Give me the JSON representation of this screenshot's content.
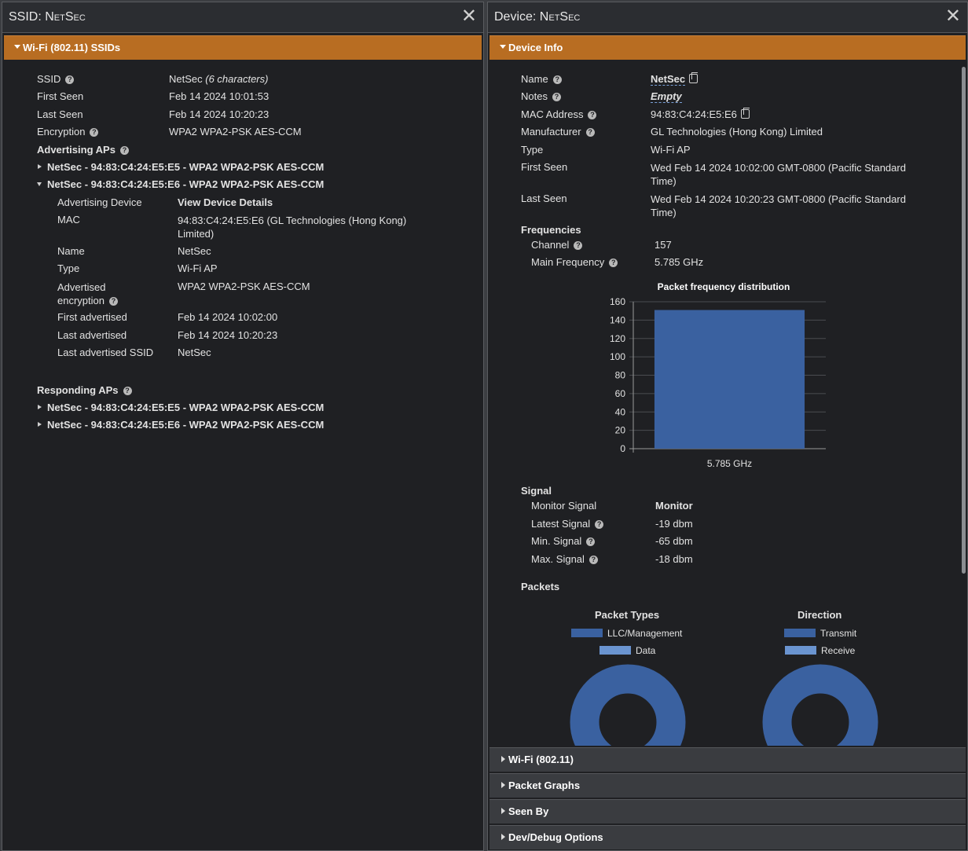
{
  "left": {
    "title_prefix": "SSID: ",
    "title_name": "NetSec",
    "section": "Wi-Fi (802.11) SSIDs",
    "fields": [
      {
        "label": "SSID",
        "value": "NetSec",
        "note": "(6 characters)"
      },
      {
        "label": "First Seen",
        "value": "Feb 14 2024 10:01:53"
      },
      {
        "label": "Last Seen",
        "value": "Feb 14 2024 10:20:23"
      },
      {
        "label": "Encryption",
        "value": "WPA2 WPA2-PSK AES-CCM"
      }
    ],
    "advertising_title": "Advertising APs",
    "advertising": [
      "NetSec - 94:83:C4:24:E5:E5 - WPA2 WPA2-PSK AES-CCM",
      "NetSec - 94:83:C4:24:E5:E6 - WPA2 WPA2-PSK AES-CCM"
    ],
    "detail": {
      "advertising_device_label": "Advertising Device",
      "advertising_device_value": "View Device Details",
      "mac_label": "MAC",
      "mac_value": "94:83:C4:24:E5:E6 (GL Technologies (Hong Kong) Limited)",
      "name_label": "Name",
      "name_value": "NetSec",
      "type_label": "Type",
      "type_value": "Wi-Fi AP",
      "adv_enc_label": "Advertised encryption",
      "adv_enc_value": "WPA2 WPA2-PSK AES-CCM",
      "first_adv_label": "First advertised",
      "first_adv_value": "Feb 14 2024 10:02:00",
      "last_adv_label": "Last advertised",
      "last_adv_value": "Feb 14 2024 10:20:23",
      "last_ssid_label": "Last advertised SSID",
      "last_ssid_value": "NetSec"
    },
    "responding_title": "Responding APs",
    "responding": [
      "NetSec - 94:83:C4:24:E5:E5 - WPA2 WPA2-PSK AES-CCM",
      "NetSec - 94:83:C4:24:E5:E6 - WPA2 WPA2-PSK AES-CCM"
    ]
  },
  "right": {
    "title_prefix": "Device: ",
    "title_name": "NetSec",
    "section": "Device Info",
    "info": {
      "name_label": "Name",
      "name_value": "NetSec",
      "notes_label": "Notes",
      "notes_value": "Empty",
      "mac_label": "MAC Address",
      "mac_value": "94:83:C4:24:E5:E6",
      "manufacturer_label": "Manufacturer",
      "manufacturer_value": "GL Technologies (Hong Kong) Limited",
      "type_label": "Type",
      "type_value": "Wi-Fi AP",
      "first_seen_label": "First Seen",
      "first_seen_value": "Wed Feb 14 2024 10:02:00 GMT-0800 (Pacific Standard Time)",
      "last_seen_label": "Last Seen",
      "last_seen_value": "Wed Feb 14 2024 10:20:23 GMT-0800 (Pacific Standard Time)"
    },
    "frequencies": {
      "title": "Frequencies",
      "channel_label": "Channel",
      "channel_value": "157",
      "main_label": "Main Frequency",
      "main_value": "5.785 GHz"
    },
    "signal": {
      "title": "Signal",
      "monitor_label": "Monitor Signal",
      "monitor_value": "Monitor",
      "latest_label": "Latest Signal",
      "latest_value": "-19 dbm",
      "min_label": "Min. Signal",
      "min_value": "-65 dbm",
      "max_label": "Max. Signal",
      "max_value": "-18 dbm"
    },
    "packets": {
      "title": "Packets",
      "types_title": "Packet Types",
      "types_legend": [
        "LLC/Management",
        "Data"
      ],
      "direction_title": "Direction",
      "direction_legend": [
        "Transmit",
        "Receive"
      ]
    },
    "collapsed_sections": [
      "Wi-Fi (802.11)",
      "Packet Graphs",
      "Seen By",
      "Dev/Debug Options"
    ]
  },
  "colors": {
    "accent_orange": "#b86d22",
    "series_dark": "#3a61a0",
    "series_light": "#6a94d0"
  },
  "chart_data": {
    "type": "bar",
    "title": "Packet frequency distribution",
    "categories": [
      "5.785 GHz"
    ],
    "values": [
      151
    ],
    "ylim": [
      0,
      160
    ],
    "yticks": [
      0,
      20,
      40,
      60,
      80,
      100,
      120,
      140,
      160
    ],
    "grid": true
  }
}
